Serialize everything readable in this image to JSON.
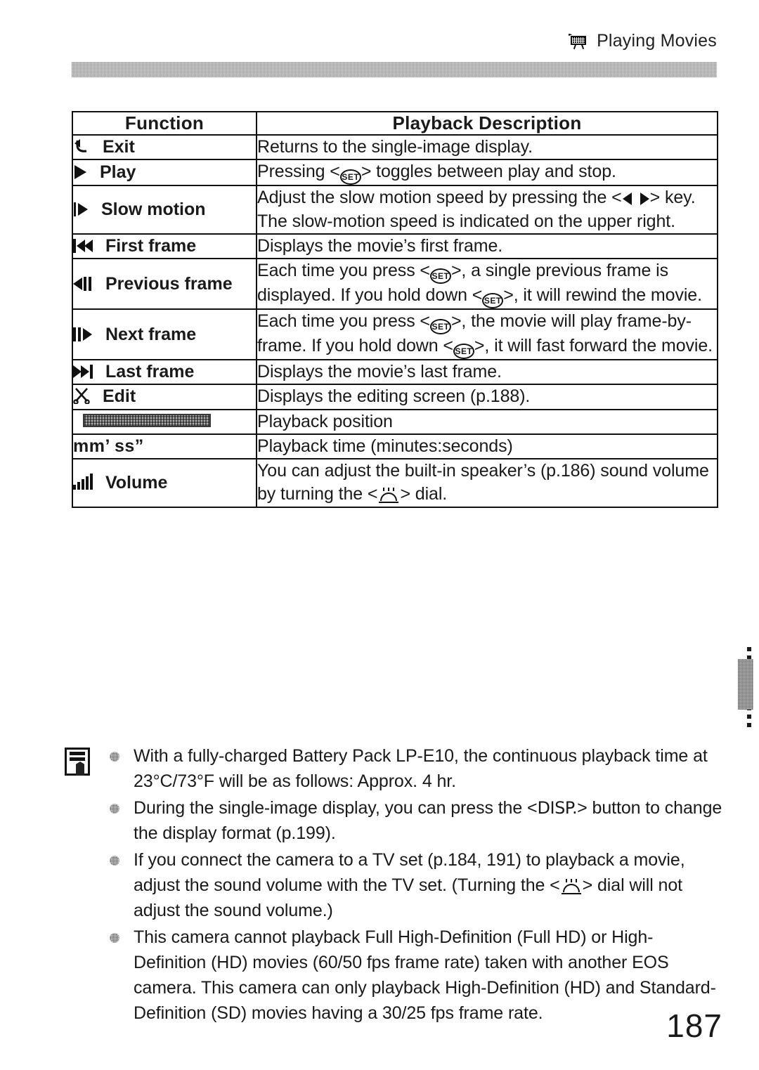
{
  "header": {
    "icon": "movie-camera-icon",
    "title": "Playing Movies"
  },
  "table": {
    "columns": [
      "Function",
      "Playback Description"
    ],
    "rows": [
      {
        "icon": "return-arrow-icon",
        "function": "Exit",
        "description": "Returns to the single-image display."
      },
      {
        "icon": "play-triangle-icon",
        "function": "Play",
        "description_pre": "Pressing <",
        "key": "SET",
        "description_post": "> toggles between play and stop."
      },
      {
        "icon": "slow-motion-icon",
        "function": "Slow motion",
        "description_pre": "Adjust the slow motion speed by pressing the <",
        "key": "cross-keys",
        "description_post": "> key. The slow-motion speed is indicated on the upper right."
      },
      {
        "icon": "first-frame-icon",
        "function": "First frame",
        "description": "Displays the movie’s first frame."
      },
      {
        "icon": "previous-frame-icon",
        "function": "Previous frame",
        "description_pre": "Each time you press <",
        "key": "SET",
        "description_mid": ">, a single previous frame is displayed. If you hold down <",
        "key2": "SET",
        "description_post": ">, it will rewind the movie."
      },
      {
        "icon": "next-frame-icon",
        "function": "Next frame",
        "description_pre": "Each time you press <",
        "key": "SET",
        "description_mid": ">, the movie will play frame-by-frame. If you hold down <",
        "key2": "SET",
        "description_post": ">, it will fast forward the movie."
      },
      {
        "icon": "last-frame-icon",
        "function": "Last frame",
        "description": "Displays the movie’s last frame."
      },
      {
        "icon": "scissors-icon",
        "function": "Edit",
        "description": "Displays the editing screen (p.188)."
      },
      {
        "icon": "playback-position-bar",
        "function": "",
        "description": "Playback position"
      },
      {
        "icon": "",
        "function": "mm’ ss”",
        "description": "Playback time (minutes:seconds)"
      },
      {
        "icon": "volume-bars-icon",
        "function": "Volume",
        "description_pre": "You can adjust the built-in speaker’s (p.186) sound volume by turning the <",
        "key": "main-dial",
        "description_post": "> dial."
      }
    ]
  },
  "notes": {
    "icon": "note-pad-icon",
    "items": [
      {
        "text": "With a fully-charged Battery Pack LP-E10, the continuous playback time at 23°C/73°F will be as follows: Approx. 4 hr."
      },
      {
        "pre": "During the single-image display, you can press the <",
        "key": "DISP.",
        "post": "> button to change the display format (p.199)."
      },
      {
        "pre": "If you connect the camera to a TV set (p.184, 191) to playback a movie, adjust the sound volume with the TV set. (Turning the <",
        "key": "main-dial",
        "post": "> dial will not adjust the sound volume.)"
      },
      {
        "text": "This camera cannot playback Full High-Definition (Full HD) or High-Definition (HD) movies (60/50 fps frame rate) taken with another EOS camera. This camera can only playback High-Definition (HD) and Standard-Definition (SD) movies having a 30/25 fps frame rate."
      }
    ]
  },
  "footer": {
    "page_number": "187"
  },
  "colors": {
    "ink": "#1a1a1a",
    "rule": "#111111",
    "band": "#c9c9c9"
  }
}
